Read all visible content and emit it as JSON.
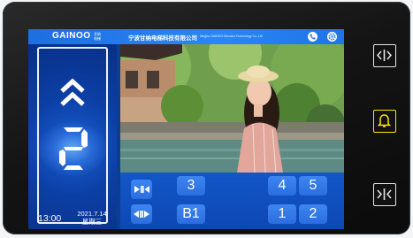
{
  "header": {
    "brand": "GAINOO",
    "brand_sub": "甘纳 电梯",
    "company": "宁波甘纳电梯科技有限公司",
    "company_en": "Ningbo GAINOO Elevator Technology Co.,Ltd",
    "phone_icon": "phone-icon",
    "settings_icon": "settings-icon"
  },
  "status": {
    "direction": "up",
    "floor": "2",
    "time": "13:00",
    "date": "2021.7.14",
    "weekday": "星期三"
  },
  "keypad": {
    "close_icon": "close-doors-icon",
    "open_icon": "open-doors-icon",
    "row1": [
      "3",
      "4",
      "5"
    ],
    "row2": [
      "B1",
      "1",
      "2"
    ]
  },
  "side_buttons": {
    "open": "door-open-icon",
    "alarm": "bell-icon",
    "close": "door-close-icon"
  },
  "colors": {
    "header_blue": "#2a86f5",
    "panel_blue": "#0c3fa5",
    "key_blue": "#2b6ddf",
    "bell_yellow": "#ffe600"
  }
}
